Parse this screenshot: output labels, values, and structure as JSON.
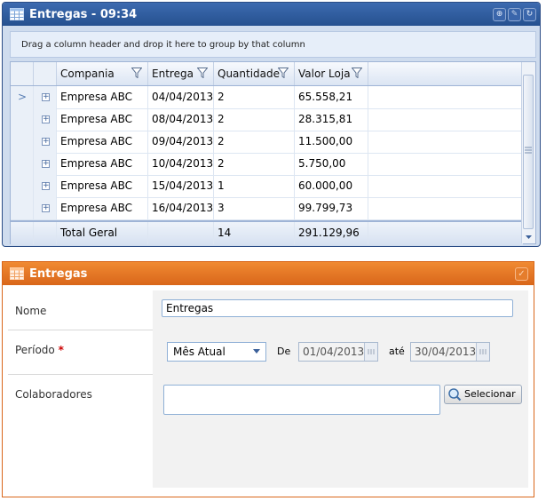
{
  "grid_panel": {
    "title": "Entregas - 09:34",
    "group_hint": "Drag a column header and drop it here to group by that column",
    "columns": [
      "Compania",
      "Entrega",
      "Quantidade",
      "Valor Loja"
    ],
    "rows": [
      {
        "compania": "Empresa ABC",
        "entrega": "04/04/2013",
        "quantidade": "2",
        "valor": "65.558,21"
      },
      {
        "compania": "Empresa ABC",
        "entrega": "08/04/2013",
        "quantidade": "2",
        "valor": "28.315,81"
      },
      {
        "compania": "Empresa ABC",
        "entrega": "09/04/2013",
        "quantidade": "2",
        "valor": "11.500,00"
      },
      {
        "compania": "Empresa ABC",
        "entrega": "10/04/2013",
        "quantidade": "2",
        "valor": "5.750,00"
      },
      {
        "compania": "Empresa ABC",
        "entrega": "15/04/2013",
        "quantidade": "1",
        "valor": "60.000,00"
      },
      {
        "compania": "Empresa ABC",
        "entrega": "16/04/2013",
        "quantidade": "3",
        "valor": "99.799,73"
      }
    ],
    "footer": {
      "label": "Total Geral",
      "quantidade": "14",
      "valor": "291.129,96"
    },
    "current_row_marker": ">",
    "expand_glyph": "+",
    "tools": [
      "zoom-icon",
      "edit-icon",
      "refresh-icon"
    ]
  },
  "form_panel": {
    "title": "Entregas",
    "nome_label": "Nome",
    "nome_value": "Entregas",
    "periodo_label": "Período",
    "required_mark": "*",
    "periodo_select": "Mês Atual",
    "de_label": "De",
    "de_value": "01/04/2013",
    "ate_label": "até",
    "ate_value": "30/04/2013",
    "colaboradores_label": "Colaboradores",
    "colaboradores_value": "",
    "selecionar_label": "Selecionar",
    "tool": "check-icon"
  },
  "colors": {
    "grid_header": "#25508f",
    "form_header": "#d9661a",
    "required": "#cc0000"
  }
}
